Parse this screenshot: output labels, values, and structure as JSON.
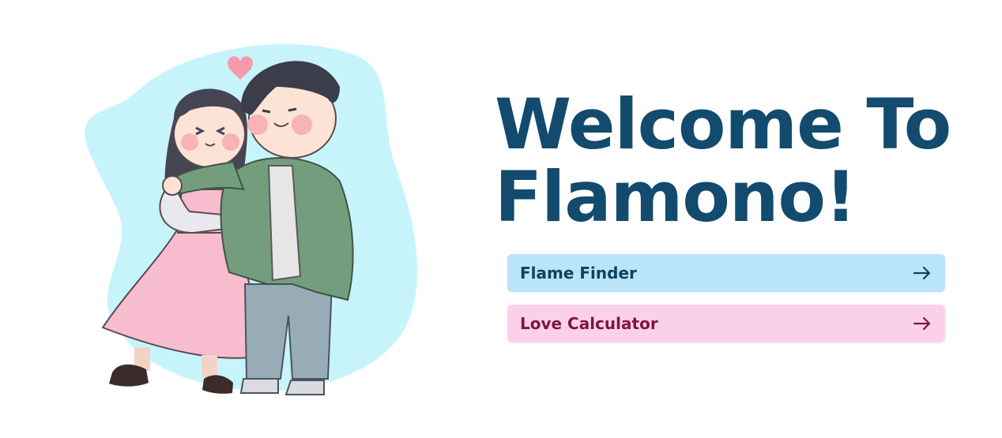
{
  "page": {
    "title": "Welcome To Flamono!"
  },
  "menu": {
    "items": [
      {
        "label": "Flame Finder",
        "icon": "arrow-right-icon",
        "bg": "#b9e4fa",
        "color": "#0f4262"
      },
      {
        "label": "Love Calculator",
        "icon": "arrow-right-icon",
        "bg": "#fbd1ea",
        "color": "#7f1443"
      }
    ]
  },
  "illustration": {
    "subject": "couple-illustration",
    "heart_color": "#f49aab",
    "blob_color": "#c7f4fb"
  }
}
